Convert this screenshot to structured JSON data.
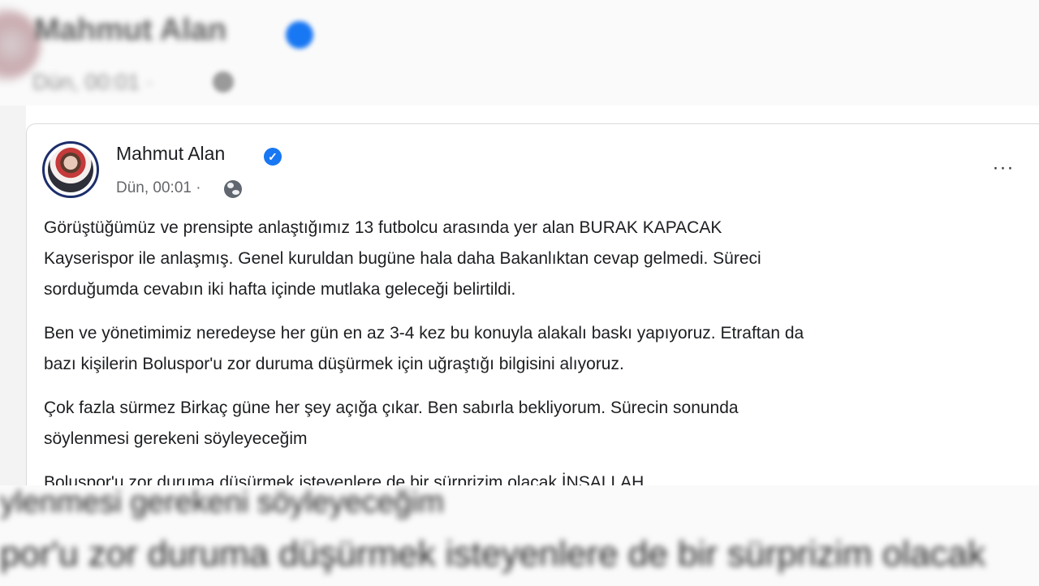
{
  "background_post": {
    "name": "Mahmut Alan",
    "meta": "Dün, 00:01 ·",
    "bottom_line_1": "ylenmesi gerekeni söyleyeceğim",
    "bottom_line_2": "por'u zor duruma düşürmek isteyenlere de bir sürprizim olacak"
  },
  "post": {
    "author": "Mahmut Alan",
    "timestamp": "Dün, 00:01 ·",
    "more_label": "···",
    "verified_glyph": "✓",
    "paragraphs": [
      "Görüştüğümüz ve prensipte anlaştığımız 13 futbolcu arasında yer alan BURAK KAPACAK\nKayserispor ile anlaşmış. Genel kuruldan bugüne hala daha Bakanlıktan cevap gelmedi. Süreci\nsorduğumda cevabın iki hafta içinde mutlaka geleceği belirtildi.",
      "Ben ve yönetimimiz neredeyse her gün en az 3-4 kez bu konuyla alakalı baskı yapıyoruz. Etraftan da\nbazı kişilerin Boluspor'u zor duruma düşürmek için uğraştığı bilgisini alıyoruz.",
      "Çok fazla sürmez Birkaç güne her şey açığa çıkar. Ben sabırla bekliyorum. Sürecin sonunda\nsöylenmesi gerekeni söyleyeceğim",
      "Boluspor'u zor duruma düşürmek isteyenlere de bir sürprizim olacak İNŞALLAH"
    ]
  },
  "colors": {
    "verified": "#1877f2",
    "meta_text": "#65676b",
    "body_text": "#1c1e21",
    "avatar_ring": "#1c2e6b"
  },
  "icons": {
    "verified": "verified-badge-icon",
    "audience": "globe-icon",
    "menu": "more-options-icon"
  }
}
